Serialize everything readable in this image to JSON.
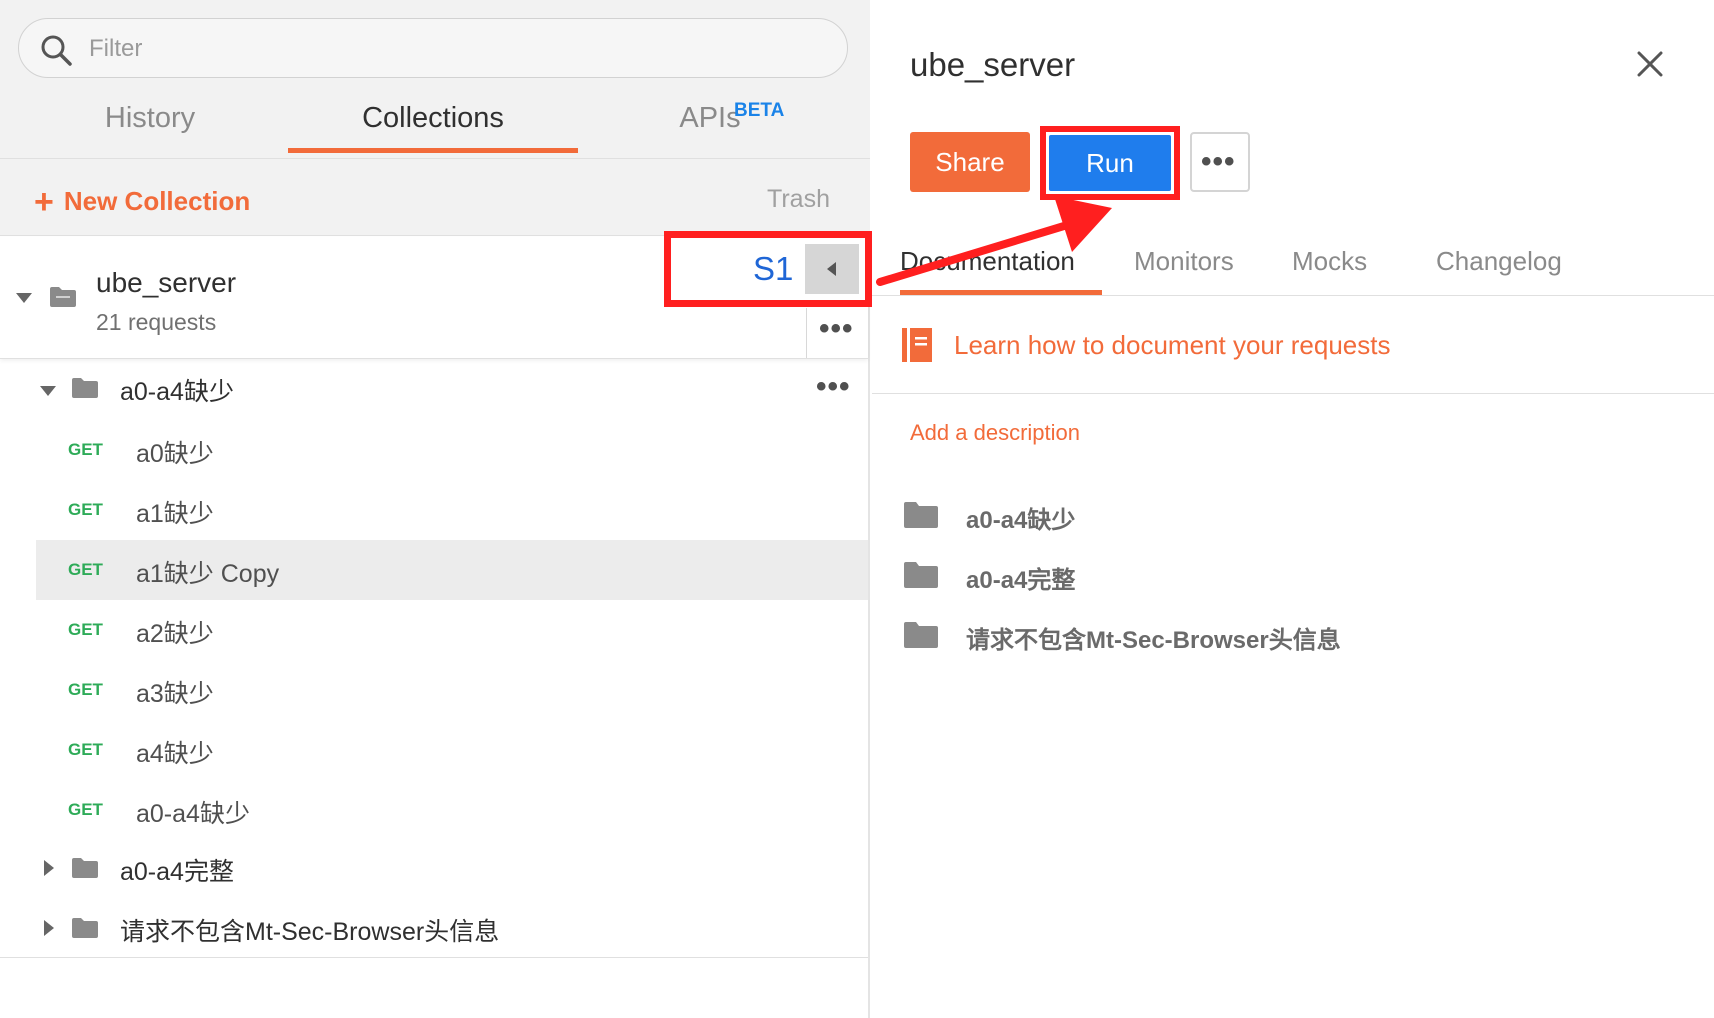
{
  "search": {
    "placeholder": "Filter",
    "value": ""
  },
  "tabs": [
    {
      "label": "History"
    },
    {
      "label": "Collections"
    },
    {
      "label": "APIs",
      "badge": "BETA"
    }
  ],
  "toolbar": {
    "new_collection": "New Collection",
    "plus": "+",
    "trash": "Trash"
  },
  "collection": {
    "name": "ube_server",
    "count": "21 requests",
    "annotation": "S1",
    "folders": [
      {
        "name": "a0-a4缺少",
        "expanded": true,
        "requests": [
          {
            "method": "GET",
            "name": "a0缺少"
          },
          {
            "method": "GET",
            "name": "a1缺少"
          },
          {
            "method": "GET",
            "name": "a1缺少 Copy",
            "selected": true
          },
          {
            "method": "GET",
            "name": "a2缺少"
          },
          {
            "method": "GET",
            "name": "a3缺少"
          },
          {
            "method": "GET",
            "name": "a4缺少"
          },
          {
            "method": "GET",
            "name": "a0-a4缺少"
          }
        ]
      },
      {
        "name": "a0-a4完整",
        "expanded": false
      },
      {
        "name": "请求不包含Mt-Sec-Browser头信息",
        "expanded": false
      }
    ]
  },
  "panel": {
    "title": "ube_server",
    "share": "Share",
    "run": "Run",
    "tabs": [
      "Documentation",
      "Monitors",
      "Mocks",
      "Changelog"
    ],
    "learn_link": "Learn how to document your requests",
    "add_description": "Add a description",
    "folders": [
      "a0-a4缺少",
      "a0-a4完整",
      "请求不包含Mt-Sec-Browser头信息"
    ]
  },
  "colors": {
    "accent": "#f26b3a",
    "run_blue": "#1f7ded",
    "get_green": "#2eab58",
    "annotation_red": "#ff1f1f",
    "annotation_text_blue": "#1f66d6"
  },
  "icons": [
    "search-icon",
    "folder-icon",
    "close-icon",
    "more-icon",
    "book-icon",
    "collapse-icon"
  ]
}
